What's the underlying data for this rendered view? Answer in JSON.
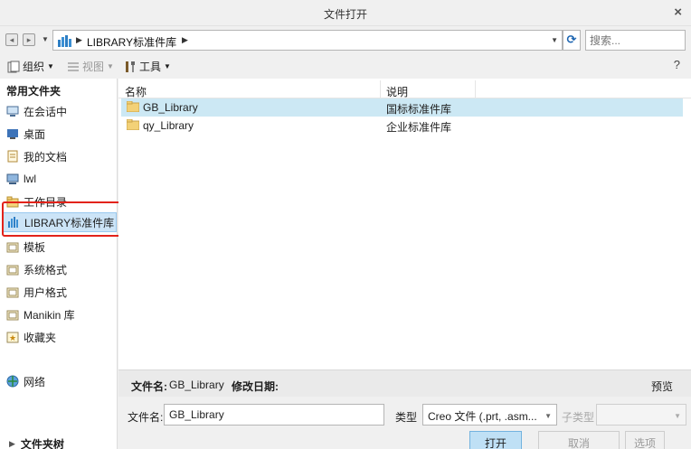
{
  "window": {
    "title": "文件打开",
    "close_glyph": "×"
  },
  "navigation": {
    "back_glyph": "◂",
    "forward_glyph": "▸",
    "address_crumb": "LIBRARY标准件库",
    "search_placeholder": "搜索..."
  },
  "toolbar": {
    "organize": "组织",
    "view": "视图",
    "tools": "工具",
    "help_glyph": "?"
  },
  "sidebar": {
    "header": "常用文件夹",
    "items": [
      {
        "label": "在会话中",
        "icon": "monitor-icon"
      },
      {
        "label": "桌面",
        "icon": "desktop-icon"
      },
      {
        "label": "我的文档",
        "icon": "documents-icon"
      },
      {
        "label": "lwl",
        "icon": "computer-icon"
      },
      {
        "label": "工作目录",
        "icon": "working-dir-icon"
      },
      {
        "label": "LIBRARY标准件库",
        "icon": "library-icon",
        "selected": true
      },
      {
        "label": "模板",
        "icon": "folder-icon"
      },
      {
        "label": "系统格式",
        "icon": "folder-icon"
      },
      {
        "label": "用户格式",
        "icon": "folder-icon"
      },
      {
        "label": "Manikin 库",
        "icon": "folder-icon"
      },
      {
        "label": "收藏夹",
        "icon": "favorites-icon"
      },
      {
        "label": "网络",
        "icon": "network-icon"
      }
    ],
    "footer": "文件夹树"
  },
  "file_list": {
    "columns": [
      "名称",
      "说明"
    ],
    "rows": [
      {
        "name": "GB_Library",
        "description": "国标标准件库",
        "selected": true
      },
      {
        "name": "qy_Library",
        "description": "企业标准件库",
        "selected": false
      }
    ]
  },
  "info_bar": {
    "filename_label": "文件名:",
    "filename_value": "GB_Library",
    "modified_label": "修改日期:",
    "preview_label": "预览"
  },
  "bottom": {
    "filename_label": "文件名:",
    "filename_value": "GB_Library",
    "type_label": "类型",
    "type_value": "Creo 文件 (.prt, .asm...",
    "subtype_label": "子类型",
    "open_button": "打开",
    "cancel_button": "取消",
    "options_button": "选项"
  },
  "colors": {
    "selection": "#cce4f7",
    "highlight_box": "#e2231a",
    "open_button": "#bfe0f5"
  }
}
